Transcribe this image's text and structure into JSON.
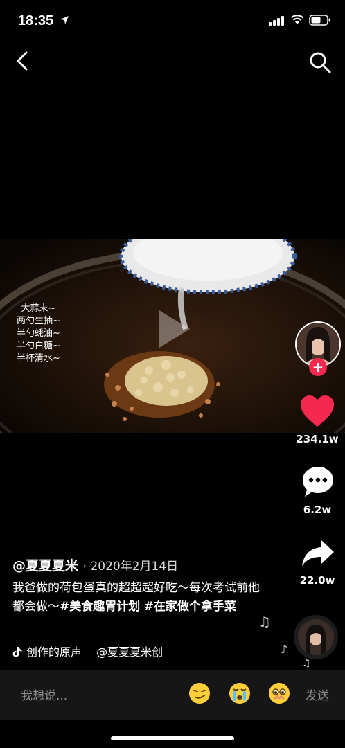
{
  "status_bar": {
    "time": "18:35"
  },
  "video": {
    "overlay_lines": [
      "大蒜末~",
      "两勺生抽~",
      "半勺蚝油~",
      "半勺白糖~",
      "半杯清水~"
    ]
  },
  "actions": {
    "like_count": "234.1w",
    "comment_count": "6.2w",
    "share_count": "22.0w",
    "follow_symbol": "+"
  },
  "post": {
    "author": "@夏夏夏米",
    "date": "2020年2月14日",
    "caption_text": "我爸做的荷包蛋真的超超超好吃～每次考试前他都会做～",
    "tags": [
      "#美食趣胃计划",
      "#在家做个拿手菜"
    ],
    "music_text": "创作的原声　 @夏夏夏米创"
  },
  "comment_bar": {
    "placeholder": "我想说...",
    "send_label": "发送"
  },
  "colors": {
    "like": "#f5294f",
    "follow": "#f5294f",
    "background": "#000000"
  }
}
